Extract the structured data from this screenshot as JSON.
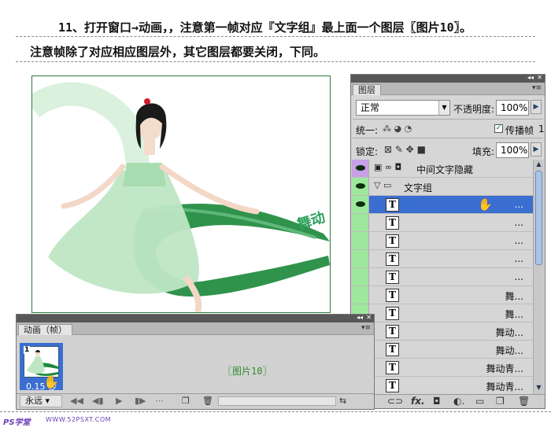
{
  "instructions": {
    "line1": "11、打开窗口→动画，，注意第一帧对应『文字组』最上面一个图层〖图片10〗。",
    "line2": "注意帧除了对应相应图层外，其它图层都要关闭，下同。"
  },
  "canvas": {
    "slogan": "舞动"
  },
  "layers_panel": {
    "tab": "图层",
    "blend_mode": "正常",
    "opacity_label": "不透明度:",
    "opacity_value": "100%",
    "unify_label": "统一:",
    "propagate_label": "传播帧",
    "propagate_num": "1",
    "lock_label": "锁定:",
    "fill_label": "填充:",
    "fill_value": "100%",
    "layers": [
      {
        "name": "中间文字隐藏",
        "type": "raster",
        "visible": true
      },
      {
        "name": "文字组",
        "type": "group",
        "visible": true
      },
      {
        "name": "...",
        "type": "text",
        "visible": true,
        "selected": true
      },
      {
        "name": "...",
        "type": "text",
        "visible": false
      },
      {
        "name": "...",
        "type": "text",
        "visible": false
      },
      {
        "name": "...",
        "type": "text",
        "visible": false
      },
      {
        "name": "...",
        "type": "text",
        "visible": false
      },
      {
        "name": "舞...",
        "type": "text",
        "visible": false
      },
      {
        "name": "舞...",
        "type": "text",
        "visible": false
      },
      {
        "name": "舞动...",
        "type": "text",
        "visible": false
      },
      {
        "name": "舞动...",
        "type": "text",
        "visible": false
      },
      {
        "name": "舞动青...",
        "type": "text",
        "visible": false
      },
      {
        "name": "舞动青...",
        "type": "text",
        "visible": false
      }
    ]
  },
  "animation_panel": {
    "tab": "动画（帧）",
    "frame_number": "1",
    "frame_delay": "0.15 秒",
    "loop": "永远",
    "annotation": "〖图片10〗"
  },
  "footer": {
    "left": "PS学堂",
    "right": "WWW.52PSXT.COM"
  },
  "colors": {
    "accent_blue": "#3a6ed0",
    "eye_green": "#9ee89e",
    "ribbon_green": "#1e8a3c",
    "annotation_green": "#2a8a2a"
  }
}
